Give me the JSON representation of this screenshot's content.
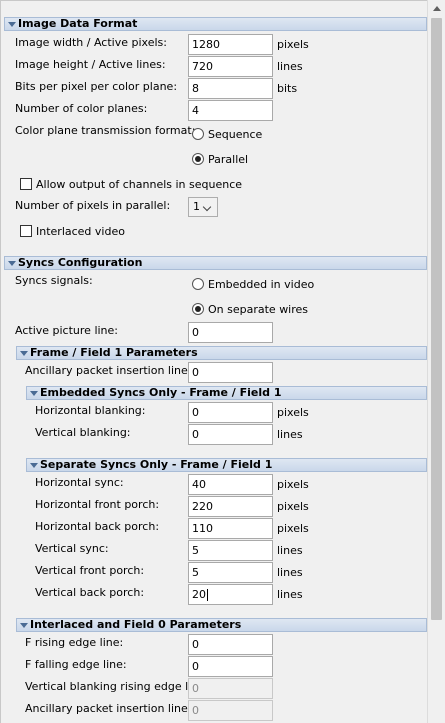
{
  "image_data_format": {
    "title": "Image Data Format",
    "width_label": "Image width / Active pixels:",
    "width_value": "1280",
    "width_unit": "pixels",
    "height_label": "Image height / Active lines:",
    "height_value": "720",
    "height_unit": "lines",
    "bpp_label": "Bits per pixel per color plane:",
    "bpp_value": "8",
    "bpp_unit": "bits",
    "planes_label": "Number of color planes:",
    "planes_value": "4",
    "tx_label": "Color plane transmission format:",
    "tx_options": [
      "Sequence",
      "Parallel"
    ],
    "tx_selected": "Parallel",
    "allow_seq_label": "Allow output of channels in sequence",
    "allow_seq_checked": false,
    "pix_parallel_label": "Number of pixels in parallel:",
    "pix_parallel_value": "1",
    "interlaced_label": "Interlaced video",
    "interlaced_checked": false
  },
  "syncs": {
    "title": "Syncs Configuration",
    "signals_label": "Syncs signals:",
    "signal_options": [
      "Embedded in video",
      "On separate wires"
    ],
    "signal_selected": "On separate wires",
    "active_line_label": "Active picture line:",
    "active_line_value": "0"
  },
  "frame1": {
    "title": "Frame / Field 1 Parameters",
    "ancillary_label": "Ancillary packet insertion line:",
    "ancillary_value": "0"
  },
  "embedded": {
    "title": "Embedded Syncs Only - Frame / Field 1",
    "hblank_label": "Horizontal blanking:",
    "hblank_value": "0",
    "hblank_unit": "pixels",
    "vblank_label": "Vertical blanking:",
    "vblank_value": "0",
    "vblank_unit": "lines"
  },
  "separate": {
    "title": "Separate Syncs Only - Frame / Field 1",
    "hsync_label": "Horizontal sync:",
    "hsync_value": "40",
    "hsync_unit": "pixels",
    "hfp_label": "Horizontal front porch:",
    "hfp_value": "220",
    "hfp_unit": "pixels",
    "hbp_label": "Horizontal back porch:",
    "hbp_value": "110",
    "hbp_unit": "pixels",
    "vsync_label": "Vertical sync:",
    "vsync_value": "5",
    "vsync_unit": "lines",
    "vfp_label": "Vertical front porch:",
    "vfp_value": "5",
    "vfp_unit": "lines",
    "vbp_label": "Vertical back porch:",
    "vbp_value": "20",
    "vbp_unit": "lines"
  },
  "field0": {
    "title": "Interlaced and Field 0 Parameters",
    "frise_label": "F rising edge line:",
    "frise_value": "0",
    "ffall_label": "F falling edge line:",
    "ffall_value": "0",
    "vbr_label": "Vertical blanking rising edge line:",
    "vbr_value": "0",
    "anc_label": "Ancillary packet insertion line:",
    "anc_value": "0"
  }
}
